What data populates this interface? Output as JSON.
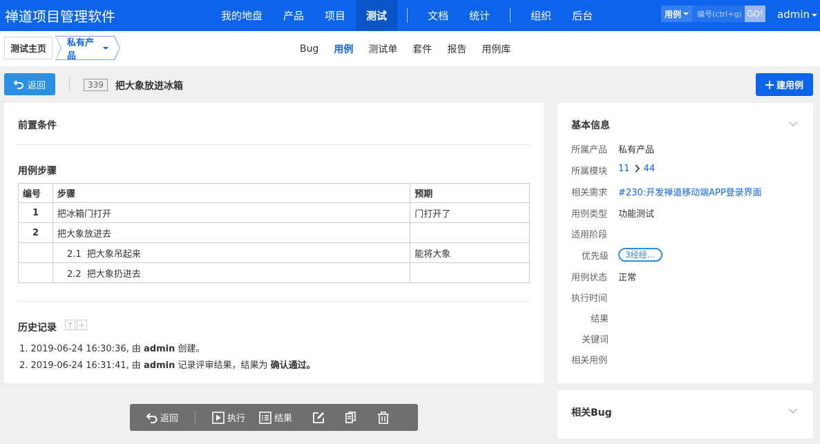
{
  "header": {
    "brand": "禅道项目管理软件",
    "nav": [
      "我的地盘",
      "产品",
      "项目",
      "测试",
      "文档",
      "统计",
      "组织",
      "后台"
    ],
    "active_nav": "测试",
    "search_type": "用例",
    "search_placeholder": "编号(ctrl+g)",
    "search_go": "GO!",
    "user": "admin"
  },
  "subnav": {
    "home": "测试主页",
    "product": "私有产品",
    "tabs": [
      "Bug",
      "用例",
      "测试单",
      "套件",
      "报告",
      "用例库"
    ],
    "active_tab": "用例"
  },
  "toolbar": {
    "back": "返回",
    "case_id": "339",
    "case_title": "把大象放进冰箱",
    "create": "建用例"
  },
  "main": {
    "precondition_title": "前置条件",
    "steps_title": "用例步骤",
    "columns": [
      "编号",
      "步骤",
      "预期"
    ],
    "steps": [
      {
        "num": "1",
        "step": "把冰箱门打开",
        "expect": "门打开了"
      },
      {
        "num": "2",
        "step": "把大象放进去",
        "expect": ""
      },
      {
        "sub": "2.1",
        "step": "把大象吊起来",
        "expect": "能将大象"
      },
      {
        "sub": "2.2",
        "step": "把大象扔进去",
        "expect": ""
      }
    ],
    "history_title": "历史记录",
    "history": [
      {
        "idx": "1.",
        "time": "2019-06-24 16:30:36, 由",
        "actor": "admin",
        "action": "创建。",
        "extra": ""
      },
      {
        "idx": "2.",
        "time": "2019-06-24 16:31:41, 由",
        "actor": "admin",
        "action": "记录评审结果，结果为",
        "extra": "确认通过。"
      }
    ]
  },
  "side": {
    "title": "基本信息",
    "rows": {
      "product_label": "所属产品",
      "product": "私有产品",
      "module_label": "所属模块",
      "module_a": "11",
      "module_b": "44",
      "story_label": "相关需求",
      "story": "#230:开发禅道移动端APP登录界面",
      "type_label": "用例类型",
      "type": "功能测试",
      "stage_label": "适用阶段",
      "pri_label": "优先级",
      "pri": "3经经…",
      "status_label": "用例状态",
      "status": "正常",
      "exec_label": "执行时间",
      "result_label": "结果",
      "keywords_label": "关键词",
      "linkcase_label": "相关用例"
    },
    "bug_title": "相关Bug"
  },
  "actions": {
    "back": "返回",
    "run": "执行",
    "result": "结果"
  },
  "colors": {
    "header_bg": "#0c64eb",
    "accent": "#0c64eb",
    "back_btn": "#2b8fe4",
    "action_bar": "#6f6f6f"
  }
}
